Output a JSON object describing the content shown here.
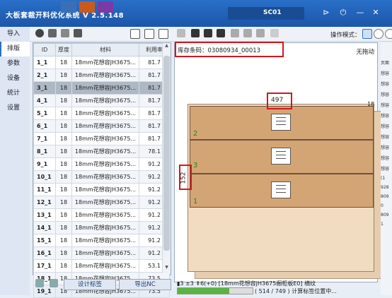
{
  "app": {
    "title": "大板套裁开料优化系统  V 2.5.148",
    "machine": "SC01",
    "brand_colors": {
      "titlebar": "#2a6fc8",
      "highlight": "#d0181e",
      "selected_row": "#aeb8c4",
      "piece_fill": "#d4a574"
    }
  },
  "window_buttons": [
    "⊳",
    "⏻",
    "—",
    "✕"
  ],
  "sidebar": {
    "items": [
      {
        "label": "导入"
      },
      {
        "label": "排版"
      },
      {
        "label": "参数"
      },
      {
        "label": "设备"
      },
      {
        "label": "统计"
      },
      {
        "label": "设置"
      }
    ],
    "active": "排版"
  },
  "toolbar": {
    "operation_mode_label": "操作模式："
  },
  "table": {
    "headers": [
      "ID",
      "厚度",
      "材料",
      "利用率"
    ],
    "rows": [
      {
        "id": "1_1",
        "thick": "18",
        "mat": "18mm花想容JH3675...",
        "rate": "81.7"
      },
      {
        "id": "2_1",
        "thick": "18",
        "mat": "18mm花想容JH3675...",
        "rate": "81.7"
      },
      {
        "id": "3_1",
        "thick": "18",
        "mat": "18mm花想容JH3675...",
        "rate": "81.7"
      },
      {
        "id": "4_1",
        "thick": "18",
        "mat": "18mm花想容JH3675...",
        "rate": "81.7"
      },
      {
        "id": "5_1",
        "thick": "18",
        "mat": "18mm花想容JH3675...",
        "rate": "81.7"
      },
      {
        "id": "6_1",
        "thick": "18",
        "mat": "18mm花想容JH3675...",
        "rate": "81.7"
      },
      {
        "id": "7_1",
        "thick": "18",
        "mat": "18mm花想容JH3675...",
        "rate": "81.7"
      },
      {
        "id": "8_1",
        "thick": "18",
        "mat": "18mm花想容JH3675...",
        "rate": "78.1"
      },
      {
        "id": "9_1",
        "thick": "18",
        "mat": "18mm花想容JH3675...",
        "rate": "91.2"
      },
      {
        "id": "10_1",
        "thick": "18",
        "mat": "18mm花想容JH3675...",
        "rate": "91.2"
      },
      {
        "id": "11_1",
        "thick": "18",
        "mat": "18mm花想容JH3675...",
        "rate": "91.2"
      },
      {
        "id": "12_1",
        "thick": "18",
        "mat": "18mm花想容JH3675...",
        "rate": "91.2"
      },
      {
        "id": "13_1",
        "thick": "18",
        "mat": "18mm花想容JH3675...",
        "rate": "91.2"
      },
      {
        "id": "14_1",
        "thick": "18",
        "mat": "18mm花想容JH3675...",
        "rate": "91.2"
      },
      {
        "id": "15_1",
        "thick": "18",
        "mat": "18mm花想容JH3675...",
        "rate": "91.2"
      },
      {
        "id": "16_1",
        "thick": "18",
        "mat": "18mm花想容JH3675...",
        "rate": "91.2"
      },
      {
        "id": "17_1",
        "thick": "18",
        "mat": "18mm花想容JH3675...",
        "rate": "53.1"
      },
      {
        "id": "18_1",
        "thick": "18",
        "mat": "18mm花想容JH3675...",
        "rate": "73.5"
      },
      {
        "id": "19_1",
        "thick": "18",
        "mat": "18mm花想容JH3675...",
        "rate": "73.5"
      }
    ],
    "selected_rows": [
      "3_1"
    ]
  },
  "bottom_buttons": {
    "print_label": "设计标签",
    "export_label": "导出NC"
  },
  "canvas": {
    "barcode_text": "库存条码：03080934_00013",
    "no_drag": "无拖动",
    "dim_width": "497",
    "dim_height": "152",
    "dim_thick": "18",
    "pieces": [
      {
        "label": "2"
      },
      {
        "label": "3"
      },
      {
        "label": "1"
      }
    ]
  },
  "status": {
    "summary": "▮3 ±3 ⇞6(+0)  [18mm花想容JH3675橱柜板E0] 横纹",
    "progress_text": "( 514 / 749 ) 计算标签位置中...",
    "progress_fraction": 0.686
  },
  "right_strip": [
    "页面",
    "想容",
    "想容",
    "想容",
    "想容",
    "想容",
    "想容",
    "想容",
    "想容",
    "想容",
    "想容",
    "(1",
    "928",
    "809",
    "0",
    "809",
    "1"
  ]
}
